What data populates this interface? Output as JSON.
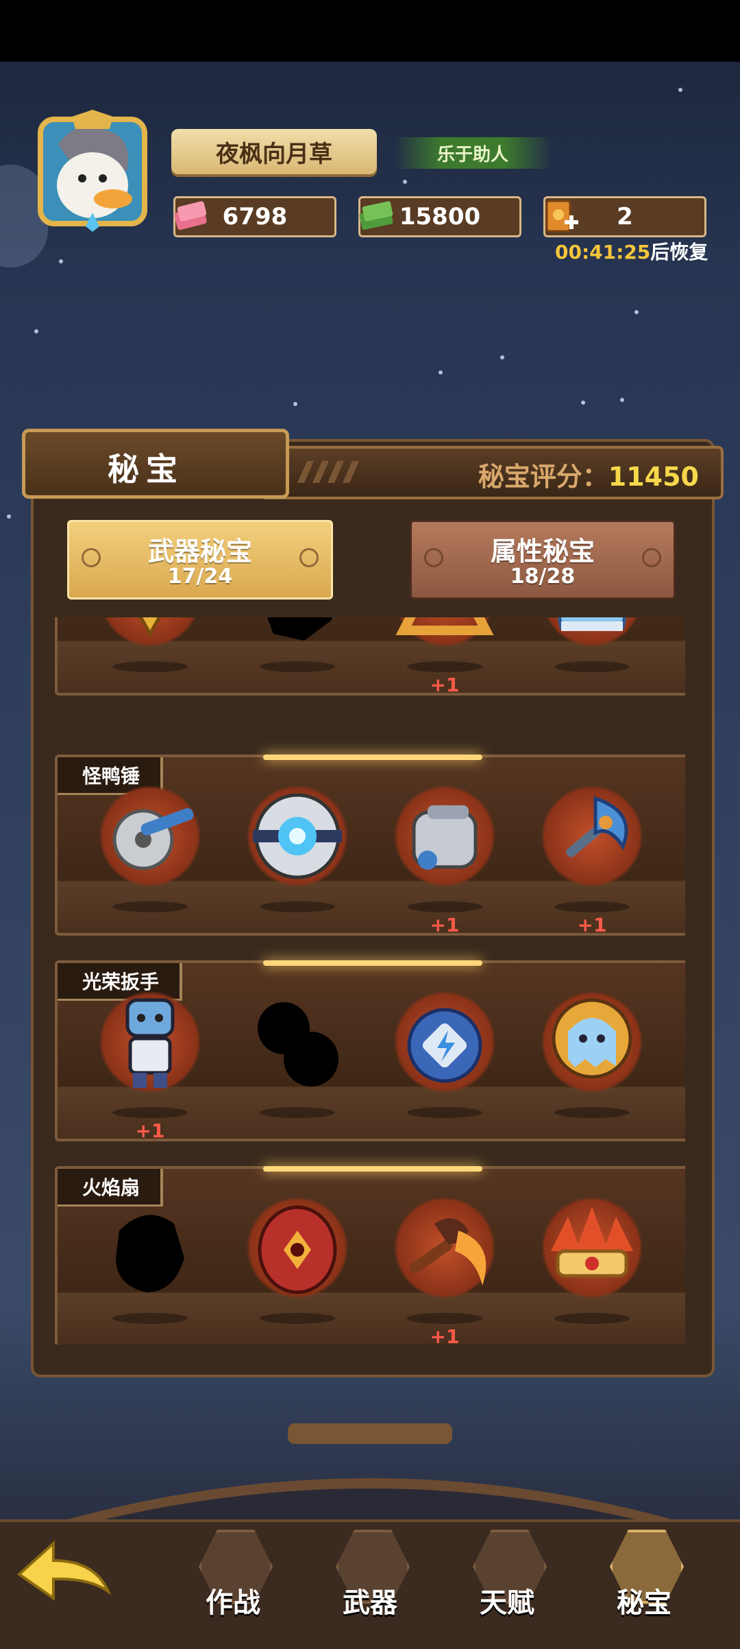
{
  "profile": {
    "name": "夜枫向月草",
    "title_badge": "乐于助人"
  },
  "resources": {
    "gems": "6798",
    "cash": "15800",
    "tickets": "2",
    "timer": "00:41:25",
    "timer_suffix": "后恢复"
  },
  "panel": {
    "title": "秘宝",
    "score_label": "秘宝评分：",
    "score_value": "11450"
  },
  "subtabs": [
    {
      "label": "武器秘宝",
      "count": "17/24"
    },
    {
      "label": "属性秘宝",
      "count": "18/28"
    }
  ],
  "shelves": [
    {
      "name": "",
      "items": [
        {
          "icon": "golden-eye-pyramid-icon",
          "plus": ""
        },
        {
          "icon": "locked-silhouette-icon",
          "plus": ""
        },
        {
          "icon": "triangle-crystal-icon",
          "plus": "+1"
        },
        {
          "icon": "ice-crown-icon",
          "plus": ""
        }
      ]
    },
    {
      "name": "怪鸭锤",
      "items": [
        {
          "icon": "saw-wrench-icon",
          "plus": ""
        },
        {
          "icon": "energy-core-icon",
          "plus": ""
        },
        {
          "icon": "mech-fist-icon",
          "plus": "+1"
        },
        {
          "icon": "battle-axe-icon",
          "plus": "+1"
        }
      ]
    },
    {
      "name": "光荣扳手",
      "items": [
        {
          "icon": "robot-figure-icon",
          "plus": "+1"
        },
        {
          "icon": "locked-gears-icon",
          "plus": ""
        },
        {
          "icon": "lightning-orb-icon",
          "plus": ""
        },
        {
          "icon": "ghost-capsule-icon",
          "plus": ""
        }
      ]
    },
    {
      "name": "火焰扇",
      "items": [
        {
          "icon": "locked-silhouette-icon",
          "plus": ""
        },
        {
          "icon": "red-eye-egg-icon",
          "plus": ""
        },
        {
          "icon": "dragon-torch-icon",
          "plus": "+1"
        },
        {
          "icon": "flame-crown-icon",
          "plus": ""
        }
      ]
    }
  ],
  "nav": [
    {
      "label": "作战",
      "icon": "battle-icon"
    },
    {
      "label": "武器",
      "icon": "weapon-icon"
    },
    {
      "label": "天赋",
      "icon": "talent-cards-icon"
    },
    {
      "label": "秘宝",
      "icon": "treasure-icon"
    }
  ],
  "colors": {
    "gold": "#f7d84a",
    "plus_red": "#ff5a4a",
    "panel_brown": "#3a2a1d"
  }
}
